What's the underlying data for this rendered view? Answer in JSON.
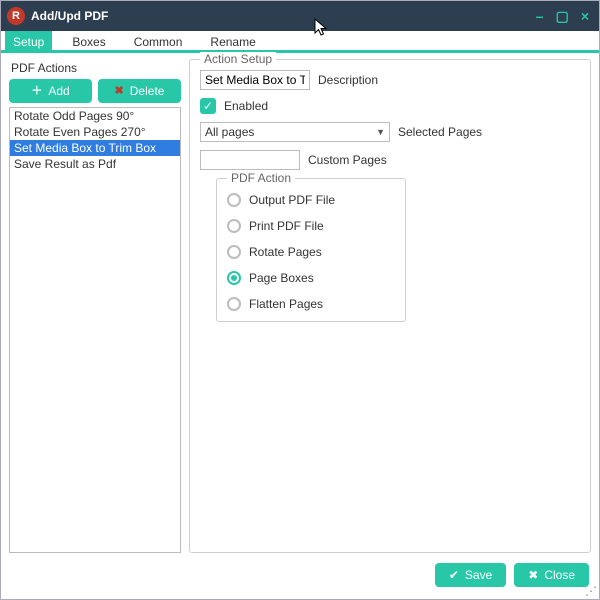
{
  "window": {
    "logo_letter": "R",
    "title": "Add/Upd PDF",
    "minimize": "–",
    "restore": "▢",
    "close": "×"
  },
  "tabs": [
    "Setup",
    "Boxes",
    "Common",
    "Rename"
  ],
  "active_tab_index": 0,
  "left": {
    "title": "PDF Actions",
    "add_glyph": "＋",
    "add_label": "Add",
    "delete_glyph": "✖",
    "delete_label": "Delete",
    "items": [
      "Rotate Odd Pages 90°",
      "Rotate Even Pages 270°",
      "Set Media Box to Trim Box",
      "Save Result as Pdf"
    ],
    "selected_index": 2
  },
  "setup": {
    "legend": "Action Setup",
    "description_value": "Set Media Box to Trim",
    "description_label": "Description",
    "enabled_checked": true,
    "enabled_label": "Enabled",
    "pages_options_selected": "All pages",
    "selected_pages_label": "Selected Pages",
    "custom_pages_label": "Custom Pages",
    "pdf_action_legend": "PDF Action",
    "radios": [
      "Output PDF File",
      "Print PDF File",
      "Rotate Pages",
      "Page Boxes",
      "Flatten Pages"
    ],
    "radio_selected_index": 3
  },
  "footer": {
    "save_glyph": "✔",
    "save_label": "Save",
    "close_glyph": "✖",
    "close_label": "Close",
    "grip": "⋰"
  }
}
